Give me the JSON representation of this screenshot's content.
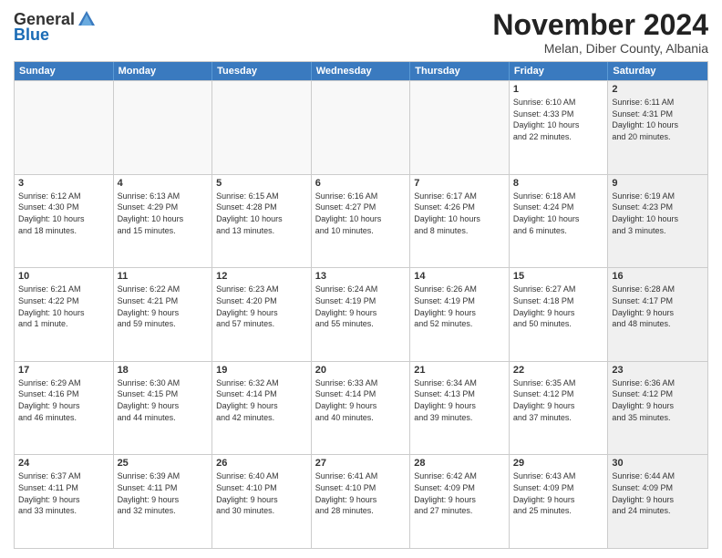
{
  "header": {
    "logo_general": "General",
    "logo_blue": "Blue",
    "month_title": "November 2024",
    "location": "Melan, Diber County, Albania"
  },
  "days_of_week": [
    "Sunday",
    "Monday",
    "Tuesday",
    "Wednesday",
    "Thursday",
    "Friday",
    "Saturday"
  ],
  "rows": [
    {
      "cells": [
        {
          "day": "",
          "info": "",
          "empty": true
        },
        {
          "day": "",
          "info": "",
          "empty": true
        },
        {
          "day": "",
          "info": "",
          "empty": true
        },
        {
          "day": "",
          "info": "",
          "empty": true
        },
        {
          "day": "",
          "info": "",
          "empty": true
        },
        {
          "day": "1",
          "info": "Sunrise: 6:10 AM\nSunset: 4:33 PM\nDaylight: 10 hours\nand 22 minutes.",
          "shaded": false
        },
        {
          "day": "2",
          "info": "Sunrise: 6:11 AM\nSunset: 4:31 PM\nDaylight: 10 hours\nand 20 minutes.",
          "shaded": true
        }
      ]
    },
    {
      "cells": [
        {
          "day": "3",
          "info": "Sunrise: 6:12 AM\nSunset: 4:30 PM\nDaylight: 10 hours\nand 18 minutes.",
          "shaded": false
        },
        {
          "day": "4",
          "info": "Sunrise: 6:13 AM\nSunset: 4:29 PM\nDaylight: 10 hours\nand 15 minutes.",
          "shaded": false
        },
        {
          "day": "5",
          "info": "Sunrise: 6:15 AM\nSunset: 4:28 PM\nDaylight: 10 hours\nand 13 minutes.",
          "shaded": false
        },
        {
          "day": "6",
          "info": "Sunrise: 6:16 AM\nSunset: 4:27 PM\nDaylight: 10 hours\nand 10 minutes.",
          "shaded": false
        },
        {
          "day": "7",
          "info": "Sunrise: 6:17 AM\nSunset: 4:26 PM\nDaylight: 10 hours\nand 8 minutes.",
          "shaded": false
        },
        {
          "day": "8",
          "info": "Sunrise: 6:18 AM\nSunset: 4:24 PM\nDaylight: 10 hours\nand 6 minutes.",
          "shaded": false
        },
        {
          "day": "9",
          "info": "Sunrise: 6:19 AM\nSunset: 4:23 PM\nDaylight: 10 hours\nand 3 minutes.",
          "shaded": true
        }
      ]
    },
    {
      "cells": [
        {
          "day": "10",
          "info": "Sunrise: 6:21 AM\nSunset: 4:22 PM\nDaylight: 10 hours\nand 1 minute.",
          "shaded": false
        },
        {
          "day": "11",
          "info": "Sunrise: 6:22 AM\nSunset: 4:21 PM\nDaylight: 9 hours\nand 59 minutes.",
          "shaded": false
        },
        {
          "day": "12",
          "info": "Sunrise: 6:23 AM\nSunset: 4:20 PM\nDaylight: 9 hours\nand 57 minutes.",
          "shaded": false
        },
        {
          "day": "13",
          "info": "Sunrise: 6:24 AM\nSunset: 4:19 PM\nDaylight: 9 hours\nand 55 minutes.",
          "shaded": false
        },
        {
          "day": "14",
          "info": "Sunrise: 6:26 AM\nSunset: 4:19 PM\nDaylight: 9 hours\nand 52 minutes.",
          "shaded": false
        },
        {
          "day": "15",
          "info": "Sunrise: 6:27 AM\nSunset: 4:18 PM\nDaylight: 9 hours\nand 50 minutes.",
          "shaded": false
        },
        {
          "day": "16",
          "info": "Sunrise: 6:28 AM\nSunset: 4:17 PM\nDaylight: 9 hours\nand 48 minutes.",
          "shaded": true
        }
      ]
    },
    {
      "cells": [
        {
          "day": "17",
          "info": "Sunrise: 6:29 AM\nSunset: 4:16 PM\nDaylight: 9 hours\nand 46 minutes.",
          "shaded": false
        },
        {
          "day": "18",
          "info": "Sunrise: 6:30 AM\nSunset: 4:15 PM\nDaylight: 9 hours\nand 44 minutes.",
          "shaded": false
        },
        {
          "day": "19",
          "info": "Sunrise: 6:32 AM\nSunset: 4:14 PM\nDaylight: 9 hours\nand 42 minutes.",
          "shaded": false
        },
        {
          "day": "20",
          "info": "Sunrise: 6:33 AM\nSunset: 4:14 PM\nDaylight: 9 hours\nand 40 minutes.",
          "shaded": false
        },
        {
          "day": "21",
          "info": "Sunrise: 6:34 AM\nSunset: 4:13 PM\nDaylight: 9 hours\nand 39 minutes.",
          "shaded": false
        },
        {
          "day": "22",
          "info": "Sunrise: 6:35 AM\nSunset: 4:12 PM\nDaylight: 9 hours\nand 37 minutes.",
          "shaded": false
        },
        {
          "day": "23",
          "info": "Sunrise: 6:36 AM\nSunset: 4:12 PM\nDaylight: 9 hours\nand 35 minutes.",
          "shaded": true
        }
      ]
    },
    {
      "cells": [
        {
          "day": "24",
          "info": "Sunrise: 6:37 AM\nSunset: 4:11 PM\nDaylight: 9 hours\nand 33 minutes.",
          "shaded": false
        },
        {
          "day": "25",
          "info": "Sunrise: 6:39 AM\nSunset: 4:11 PM\nDaylight: 9 hours\nand 32 minutes.",
          "shaded": false
        },
        {
          "day": "26",
          "info": "Sunrise: 6:40 AM\nSunset: 4:10 PM\nDaylight: 9 hours\nand 30 minutes.",
          "shaded": false
        },
        {
          "day": "27",
          "info": "Sunrise: 6:41 AM\nSunset: 4:10 PM\nDaylight: 9 hours\nand 28 minutes.",
          "shaded": false
        },
        {
          "day": "28",
          "info": "Sunrise: 6:42 AM\nSunset: 4:09 PM\nDaylight: 9 hours\nand 27 minutes.",
          "shaded": false
        },
        {
          "day": "29",
          "info": "Sunrise: 6:43 AM\nSunset: 4:09 PM\nDaylight: 9 hours\nand 25 minutes.",
          "shaded": false
        },
        {
          "day": "30",
          "info": "Sunrise: 6:44 AM\nSunset: 4:09 PM\nDaylight: 9 hours\nand 24 minutes.",
          "shaded": true
        }
      ]
    }
  ]
}
